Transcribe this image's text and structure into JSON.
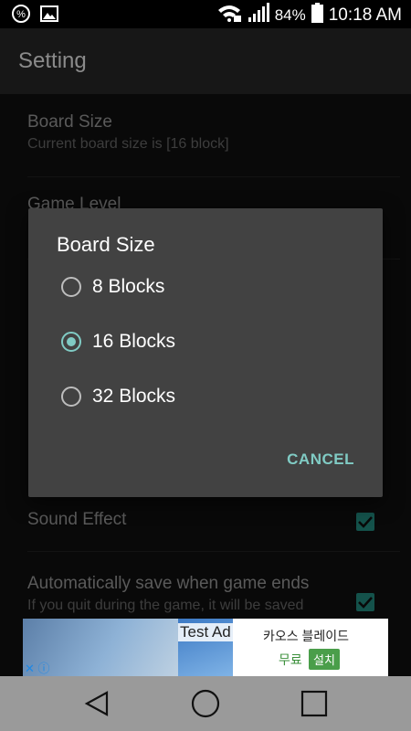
{
  "status_bar": {
    "battery": "84%",
    "time": "10:18 AM",
    "left_icons": [
      "percent-notification-icon",
      "image-notification-icon"
    ],
    "right_icons": [
      "wifi-lock-icon",
      "signal-icon",
      "battery-icon"
    ]
  },
  "app_bar": {
    "title": "Setting"
  },
  "settings": {
    "board_size": {
      "title": "Board Size",
      "summary": "Current board size is [16 block]"
    },
    "game_level": {
      "title": "Game Level"
    },
    "sound_effect": {
      "title": "Sound Effect",
      "checked": true
    },
    "auto_save": {
      "title": "Automatically save when game ends",
      "summary": "If you quit during the game, it will be saved",
      "checked": true
    }
  },
  "ad": {
    "label": "Test Ad",
    "app_name": "카오스 블레이드",
    "free": "무료",
    "install": "설치",
    "info": "✕ ⓘ"
  },
  "dialog": {
    "title": "Board Size",
    "options": [
      {
        "label": "8 Blocks",
        "selected": false
      },
      {
        "label": "16 Blocks",
        "selected": true
      },
      {
        "label": "32 Blocks",
        "selected": false
      }
    ],
    "cancel": "CANCEL"
  },
  "colors": {
    "accent": "#80cbc4",
    "checkbox": "#1f7e73",
    "dialog_bg": "#424242"
  },
  "nav_bar": {
    "buttons": [
      "back-icon",
      "home-icon",
      "recents-icon"
    ]
  }
}
